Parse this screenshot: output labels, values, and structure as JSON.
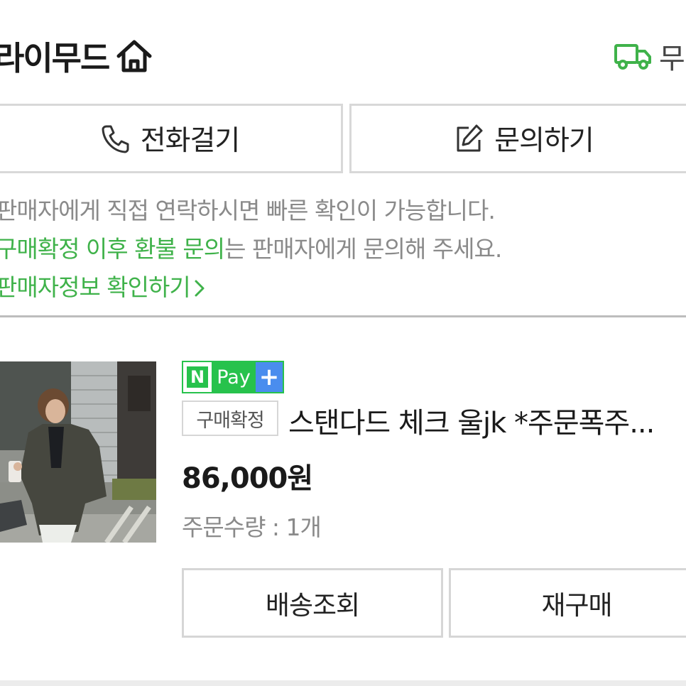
{
  "header": {
    "store_name": "라이무드",
    "delivery_text": "무료"
  },
  "contact": {
    "call_label": "전화걸기",
    "inquiry_label": "문의하기"
  },
  "notice": {
    "line1": "판매자에게 직접 연락하시면 빠른 확인이 가능합니다.",
    "line2_highlight": "구매확정 이후 환불 문의",
    "line2_rest": "는 판매자에게 문의해 주세요.",
    "line3_link": "판매자정보 확인하기"
  },
  "order": {
    "npay_n": "N",
    "npay_pay": "Pay",
    "npay_plus": "+",
    "status": "구매확정",
    "product_name": "스탠다드 체크 울jk *주문폭주...",
    "price": "86,000원",
    "quantity_label": "주문수량 : 1개"
  },
  "actions": {
    "track_label": "배송조회",
    "reorder_label": "재구매"
  },
  "colors": {
    "accent_green": "#3fb24a",
    "npay_green": "#27c24c",
    "npay_blue": "#4a8dee",
    "border": "#d6d6d6"
  }
}
